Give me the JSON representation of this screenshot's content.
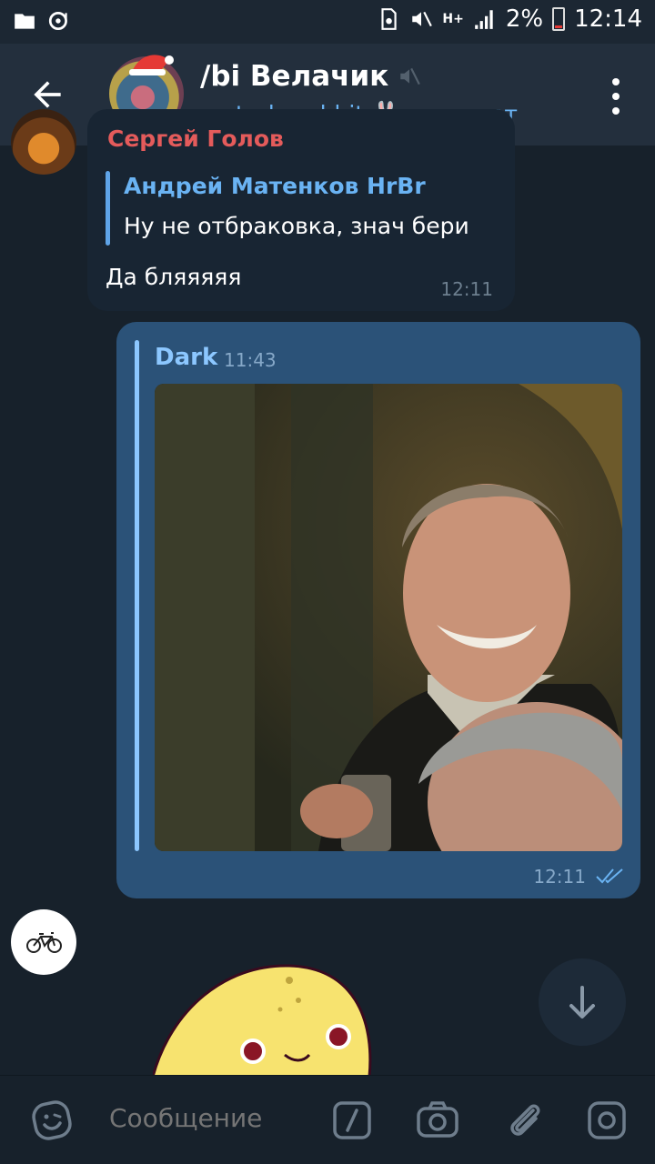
{
  "status_bar": {
    "battery_percent": "2%",
    "time": "12:14",
    "network": "H+"
  },
  "header": {
    "title": "/bi Велачик",
    "typing_user": "turborabbit",
    "typing_status": "печатает",
    "typing_emoji": "🐰"
  },
  "messages": {
    "incoming": {
      "sender_partial": "Сергей Голов",
      "reply_to_name": "Андрей Матенков HrBr",
      "reply_to_text": "Ну не отбраковка, знач бери",
      "text": "Да бляяяяя",
      "time": "12:11"
    },
    "outgoing": {
      "forwarded_from": "Dark",
      "forwarded_time": "11:43",
      "time": "12:11"
    }
  },
  "input": {
    "placeholder": "Сообщение"
  },
  "colors": {
    "accent": "#6ab3f3",
    "outgoing_bubble": "#2b5278",
    "incoming_bubble": "#182533",
    "header": "#232f3d"
  }
}
